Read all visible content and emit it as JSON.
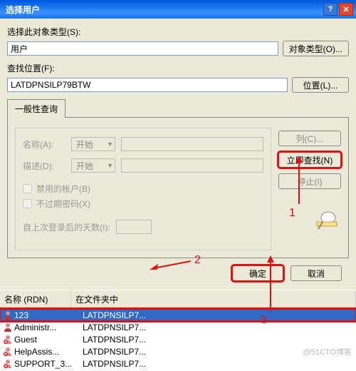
{
  "titlebar": {
    "title": "选择用户"
  },
  "object_type": {
    "label": "选择此对象类型(S):",
    "value": "用户",
    "btn": "对象类型(O)..."
  },
  "location": {
    "label": "查找位置(F):",
    "value": "LATDPNSILP79BTW",
    "btn": "位置(L)..."
  },
  "tab": {
    "label": "一般性查询"
  },
  "panel": {
    "name_label": "名称(A):",
    "name_combo": "开始",
    "desc_label": "描述(D):",
    "desc_combo": "开始",
    "chk_disabled": "禁用的帐户(B)",
    "chk_no_expire": "不过期密码(X)",
    "days_label": "自上次登录后的天数(I):"
  },
  "side": {
    "columns": "列(C)...",
    "find_now": "立即查找(N)",
    "stop": "停止(I)"
  },
  "bottom": {
    "ok": "确定",
    "cancel": "取消"
  },
  "list": {
    "header_name": "名称 (RDN)",
    "header_folder": "在文件夹中",
    "rows": [
      {
        "name": "123",
        "folder": "LATDPNSILP7...",
        "icon": "user",
        "sel": true
      },
      {
        "name": "Administr...",
        "folder": "LATDPNSILP7...",
        "icon": "user",
        "sel": false
      },
      {
        "name": "Guest",
        "folder": "LATDPNSILP7...",
        "icon": "user-x",
        "sel": false
      },
      {
        "name": "HelpAssis...",
        "folder": "LATDPNSILP7...",
        "icon": "user-x",
        "sel": false
      },
      {
        "name": "SUPPORT_3...",
        "folder": "LATDPNSILP7...",
        "icon": "user-x",
        "sel": false
      }
    ]
  },
  "annotations": {
    "a1": "1",
    "a2": "2",
    "a3": "3"
  },
  "watermark": "@51CTO博客"
}
